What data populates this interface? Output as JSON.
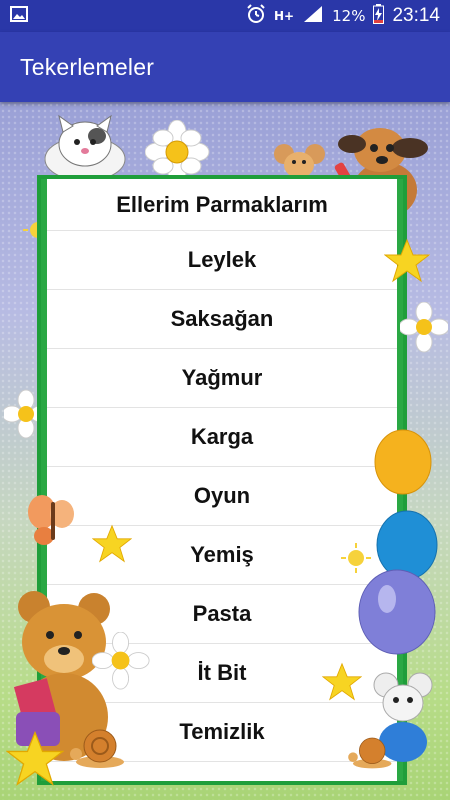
{
  "status_bar": {
    "network": "H+",
    "battery_percent": "12%",
    "time": "23:14",
    "icons": [
      "gallery-icon",
      "alarm-icon",
      "network-icon",
      "signal-icon",
      "battery-icon"
    ]
  },
  "app_bar": {
    "title": "Tekerlemeler"
  },
  "rhymes": [
    "Ellerim Parmaklarım",
    "Leylek",
    "Saksağan",
    "Yağmur",
    "Karga",
    "Oyun",
    "Yemiş",
    "Pasta",
    "İt Bit",
    "Temizlik"
  ],
  "colors": {
    "status_bar": "#2a37a8",
    "app_bar": "#3441b4",
    "frame_border": "#1f9e3a"
  }
}
